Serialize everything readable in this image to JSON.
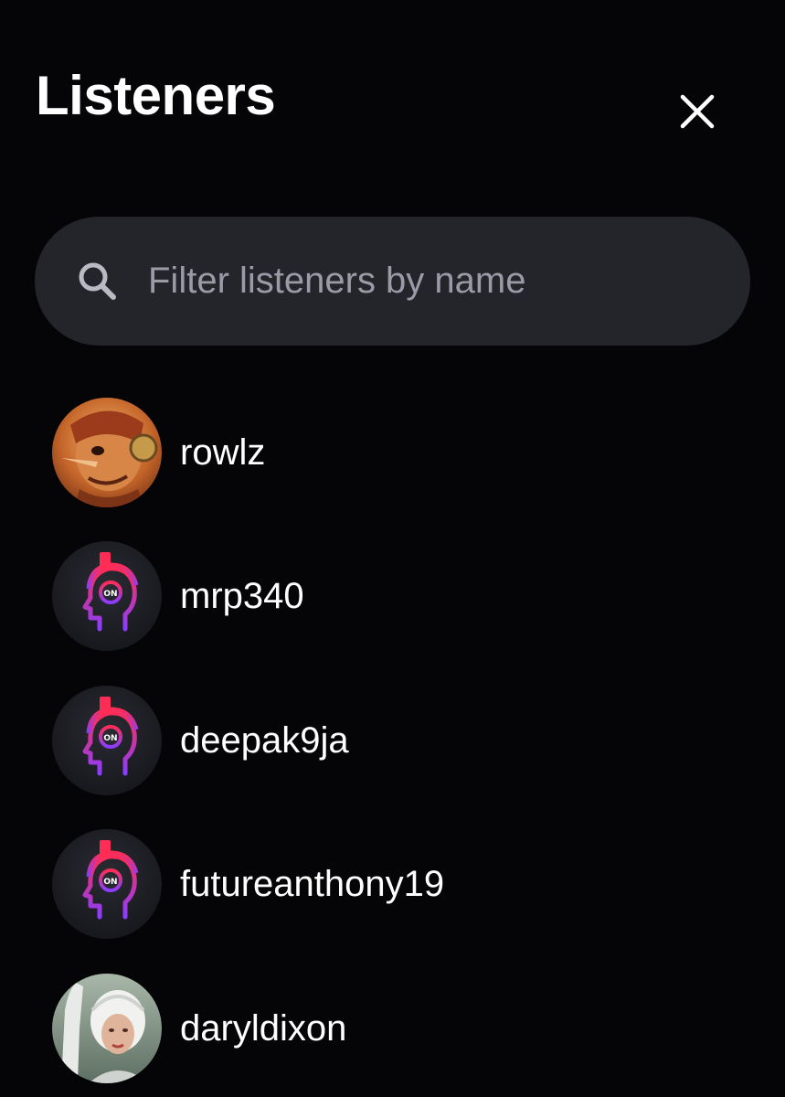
{
  "header": {
    "title": "Listeners",
    "close_icon": "close-icon"
  },
  "search": {
    "placeholder": "Filter listeners by name",
    "value": "",
    "icon": "search-icon"
  },
  "listeners": [
    {
      "username": "rowlz",
      "avatar": "custom-photo"
    },
    {
      "username": "mrp340",
      "avatar": "default-headphones"
    },
    {
      "username": "deepak9ja",
      "avatar": "default-headphones"
    },
    {
      "username": "futureanthony19",
      "avatar": "default-headphones"
    },
    {
      "username": "daryldixon",
      "avatar": "custom-photo"
    }
  ],
  "colors": {
    "background": "#050507",
    "search_background": "#24252b",
    "placeholder": "#9a9ba6",
    "accent_gradient_start": "#ff2d55",
    "accent_gradient_end": "#8a3dff"
  }
}
